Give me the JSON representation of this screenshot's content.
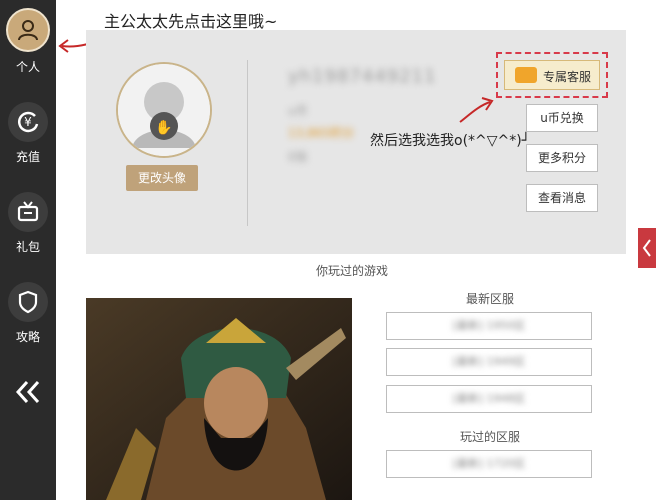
{
  "sidebar": {
    "items": [
      {
        "label": "个人",
        "icon": "user-icon",
        "active": true
      },
      {
        "label": "充值",
        "icon": "yuan-refresh-icon"
      },
      {
        "label": "礼包",
        "icon": "tv-gift-icon"
      },
      {
        "label": "攻略",
        "icon": "shield-icon"
      }
    ],
    "collapse_icon": "double-chevron-left-icon"
  },
  "annotations": {
    "top": "主公太太先点击这里哦~",
    "middle": "然后选我选我o(*^▽^*)┘"
  },
  "profile": {
    "change_avatar": "更改头像",
    "uid_blurred": "yh1987449211",
    "line1": "u币",
    "line2": "13,865积分",
    "line3": "0张"
  },
  "actions": {
    "vip_service": "专属客服",
    "exchange": "u币兑换",
    "more_points": "更多积分",
    "messages": "查看消息"
  },
  "games": {
    "title": "你玩过的游戏",
    "latest_title": "最新区服",
    "latest": [
      "[最新] 1950区",
      "[最新] 1949区",
      "[最新] 1948区"
    ],
    "played_title": "玩过的区服",
    "played": [
      "[最新] 1720区"
    ]
  },
  "colors": {
    "sidebar": "#2b2b2b",
    "active_avatar": "#c9a97a",
    "accent_red": "#d83a4a",
    "button_gold": "#bfa27a"
  }
}
